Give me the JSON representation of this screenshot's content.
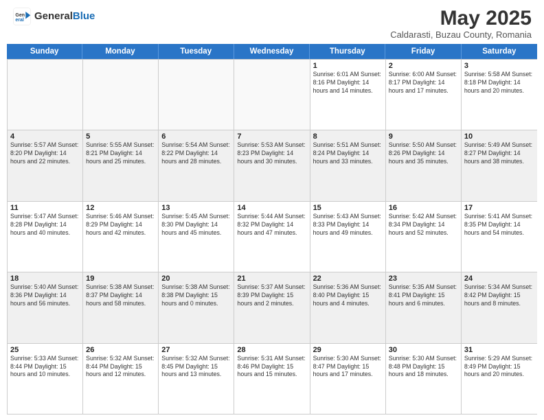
{
  "header": {
    "logo_general": "General",
    "logo_blue": "Blue",
    "title": "May 2025",
    "location": "Caldarasti, Buzau County, Romania"
  },
  "days_of_week": [
    "Sunday",
    "Monday",
    "Tuesday",
    "Wednesday",
    "Thursday",
    "Friday",
    "Saturday"
  ],
  "weeks": [
    [
      {
        "day": "",
        "info": "",
        "empty": true
      },
      {
        "day": "",
        "info": "",
        "empty": true
      },
      {
        "day": "",
        "info": "",
        "empty": true
      },
      {
        "day": "",
        "info": "",
        "empty": true
      },
      {
        "day": "1",
        "info": "Sunrise: 6:01 AM\nSunset: 8:16 PM\nDaylight: 14 hours\nand 14 minutes.",
        "empty": false
      },
      {
        "day": "2",
        "info": "Sunrise: 6:00 AM\nSunset: 8:17 PM\nDaylight: 14 hours\nand 17 minutes.",
        "empty": false
      },
      {
        "day": "3",
        "info": "Sunrise: 5:58 AM\nSunset: 8:18 PM\nDaylight: 14 hours\nand 20 minutes.",
        "empty": false
      }
    ],
    [
      {
        "day": "4",
        "info": "Sunrise: 5:57 AM\nSunset: 8:20 PM\nDaylight: 14 hours\nand 22 minutes.",
        "empty": false
      },
      {
        "day": "5",
        "info": "Sunrise: 5:55 AM\nSunset: 8:21 PM\nDaylight: 14 hours\nand 25 minutes.",
        "empty": false
      },
      {
        "day": "6",
        "info": "Sunrise: 5:54 AM\nSunset: 8:22 PM\nDaylight: 14 hours\nand 28 minutes.",
        "empty": false
      },
      {
        "day": "7",
        "info": "Sunrise: 5:53 AM\nSunset: 8:23 PM\nDaylight: 14 hours\nand 30 minutes.",
        "empty": false
      },
      {
        "day": "8",
        "info": "Sunrise: 5:51 AM\nSunset: 8:24 PM\nDaylight: 14 hours\nand 33 minutes.",
        "empty": false
      },
      {
        "day": "9",
        "info": "Sunrise: 5:50 AM\nSunset: 8:26 PM\nDaylight: 14 hours\nand 35 minutes.",
        "empty": false
      },
      {
        "day": "10",
        "info": "Sunrise: 5:49 AM\nSunset: 8:27 PM\nDaylight: 14 hours\nand 38 minutes.",
        "empty": false
      }
    ],
    [
      {
        "day": "11",
        "info": "Sunrise: 5:47 AM\nSunset: 8:28 PM\nDaylight: 14 hours\nand 40 minutes.",
        "empty": false
      },
      {
        "day": "12",
        "info": "Sunrise: 5:46 AM\nSunset: 8:29 PM\nDaylight: 14 hours\nand 42 minutes.",
        "empty": false
      },
      {
        "day": "13",
        "info": "Sunrise: 5:45 AM\nSunset: 8:30 PM\nDaylight: 14 hours\nand 45 minutes.",
        "empty": false
      },
      {
        "day": "14",
        "info": "Sunrise: 5:44 AM\nSunset: 8:32 PM\nDaylight: 14 hours\nand 47 minutes.",
        "empty": false
      },
      {
        "day": "15",
        "info": "Sunrise: 5:43 AM\nSunset: 8:33 PM\nDaylight: 14 hours\nand 49 minutes.",
        "empty": false
      },
      {
        "day": "16",
        "info": "Sunrise: 5:42 AM\nSunset: 8:34 PM\nDaylight: 14 hours\nand 52 minutes.",
        "empty": false
      },
      {
        "day": "17",
        "info": "Sunrise: 5:41 AM\nSunset: 8:35 PM\nDaylight: 14 hours\nand 54 minutes.",
        "empty": false
      }
    ],
    [
      {
        "day": "18",
        "info": "Sunrise: 5:40 AM\nSunset: 8:36 PM\nDaylight: 14 hours\nand 56 minutes.",
        "empty": false
      },
      {
        "day": "19",
        "info": "Sunrise: 5:38 AM\nSunset: 8:37 PM\nDaylight: 14 hours\nand 58 minutes.",
        "empty": false
      },
      {
        "day": "20",
        "info": "Sunrise: 5:38 AM\nSunset: 8:38 PM\nDaylight: 15 hours\nand 0 minutes.",
        "empty": false
      },
      {
        "day": "21",
        "info": "Sunrise: 5:37 AM\nSunset: 8:39 PM\nDaylight: 15 hours\nand 2 minutes.",
        "empty": false
      },
      {
        "day": "22",
        "info": "Sunrise: 5:36 AM\nSunset: 8:40 PM\nDaylight: 15 hours\nand 4 minutes.",
        "empty": false
      },
      {
        "day": "23",
        "info": "Sunrise: 5:35 AM\nSunset: 8:41 PM\nDaylight: 15 hours\nand 6 minutes.",
        "empty": false
      },
      {
        "day": "24",
        "info": "Sunrise: 5:34 AM\nSunset: 8:42 PM\nDaylight: 15 hours\nand 8 minutes.",
        "empty": false
      }
    ],
    [
      {
        "day": "25",
        "info": "Sunrise: 5:33 AM\nSunset: 8:44 PM\nDaylight: 15 hours\nand 10 minutes.",
        "empty": false
      },
      {
        "day": "26",
        "info": "Sunrise: 5:32 AM\nSunset: 8:44 PM\nDaylight: 15 hours\nand 12 minutes.",
        "empty": false
      },
      {
        "day": "27",
        "info": "Sunrise: 5:32 AM\nSunset: 8:45 PM\nDaylight: 15 hours\nand 13 minutes.",
        "empty": false
      },
      {
        "day": "28",
        "info": "Sunrise: 5:31 AM\nSunset: 8:46 PM\nDaylight: 15 hours\nand 15 minutes.",
        "empty": false
      },
      {
        "day": "29",
        "info": "Sunrise: 5:30 AM\nSunset: 8:47 PM\nDaylight: 15 hours\nand 17 minutes.",
        "empty": false
      },
      {
        "day": "30",
        "info": "Sunrise: 5:30 AM\nSunset: 8:48 PM\nDaylight: 15 hours\nand 18 minutes.",
        "empty": false
      },
      {
        "day": "31",
        "info": "Sunrise: 5:29 AM\nSunset: 8:49 PM\nDaylight: 15 hours\nand 20 minutes.",
        "empty": false
      }
    ]
  ]
}
